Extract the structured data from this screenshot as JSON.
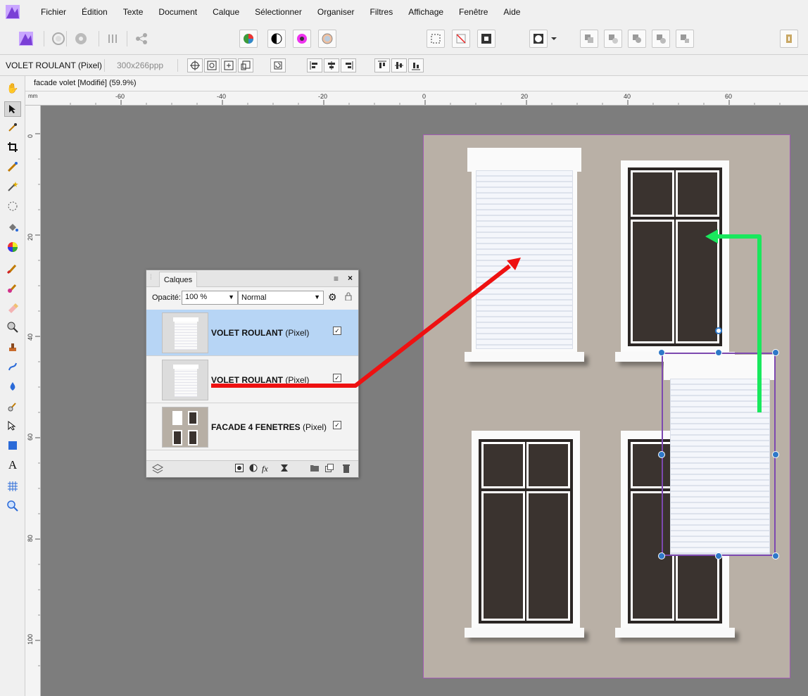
{
  "menu": [
    "Fichier",
    "Édition",
    "Texte",
    "Document",
    "Calque",
    "Sélectionner",
    "Organiser",
    "Filtres",
    "Affichage",
    "Fenêtre",
    "Aide"
  ],
  "context": {
    "layer_name": "VOLET ROULANT (Pixel)",
    "dpi": "300x266ppp"
  },
  "document_tab": {
    "title": "facade volet [Modifié] (59.9%)"
  },
  "ruler": {
    "unit": "mm",
    "top_labels": [
      "-60",
      "-40",
      "-20",
      "0",
      "20",
      "40",
      "60"
    ],
    "left_labels": [
      "0",
      "20",
      "40",
      "60",
      "80",
      "100"
    ]
  },
  "layers_panel": {
    "tab": "Calques",
    "opacity_label": "Opacité:",
    "opacity": "100 %",
    "blend_mode": "Normal",
    "layers": [
      {
        "name": "VOLET ROULANT",
        "type": "(Pixel)",
        "visible": true,
        "selected": true
      },
      {
        "name": "VOLET ROULANT",
        "type": "(Pixel)",
        "visible": true,
        "selected": false
      },
      {
        "name": "FACADE 4 FENETRES",
        "type": "(Pixel)",
        "visible": true,
        "selected": false
      }
    ]
  },
  "colors": {
    "accent": "#2e78c8",
    "selection": "#7d49b0",
    "red_arrow": "#ee1111",
    "green_arrow": "#19e85d"
  }
}
